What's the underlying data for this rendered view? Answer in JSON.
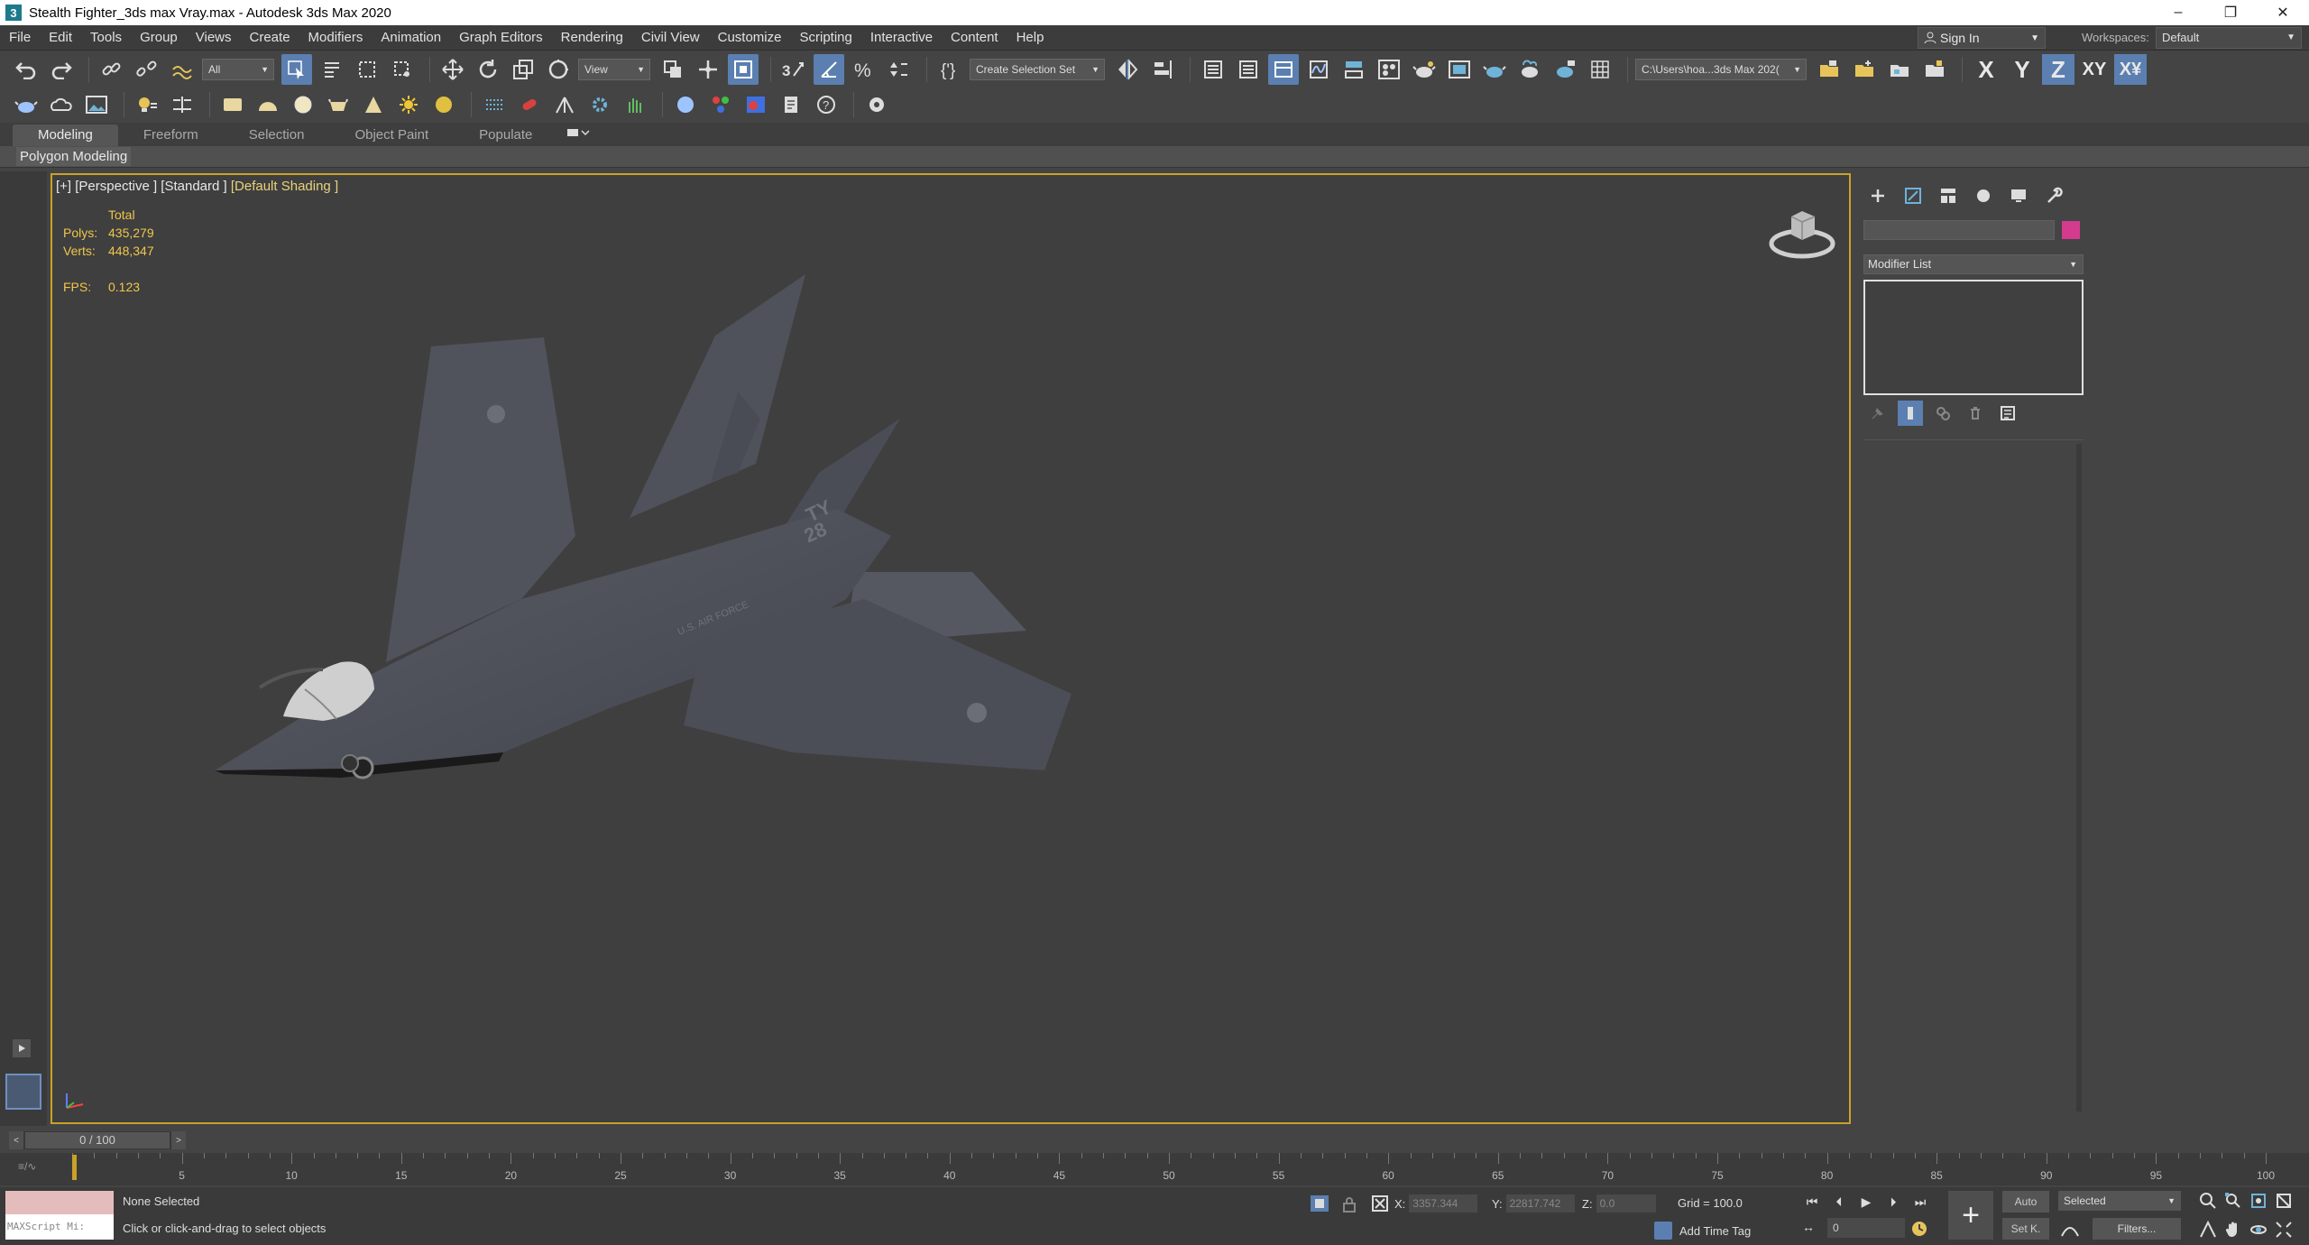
{
  "window": {
    "title": "Stealth Fighter_3ds max Vray.max - Autodesk 3ds Max 2020",
    "app_icon": "3",
    "minimize": "–",
    "maximize": "❐",
    "close": "✕"
  },
  "menu": [
    "File",
    "Edit",
    "Tools",
    "Group",
    "Views",
    "Create",
    "Modifiers",
    "Animation",
    "Graph Editors",
    "Rendering",
    "Civil View",
    "Customize",
    "Scripting",
    "Interactive",
    "Content",
    "Help"
  ],
  "account": {
    "sign_in": "Sign In",
    "workspaces_label": "Workspaces:",
    "workspace_value": "Default"
  },
  "toolbar": {
    "selection_filter": "All",
    "ref_coord": "View",
    "named_selection": "Create Selection Set",
    "project_path": "C:\\Users\\hoa...3ds Max 202(",
    "axes": [
      "X",
      "Y",
      "Z",
      "XY",
      "X¥"
    ]
  },
  "ribbon": {
    "tabs": [
      "Modeling",
      "Freeform",
      "Selection",
      "Object Paint",
      "Populate"
    ],
    "active_tab": "Modeling",
    "sub_label": "Polygon Modeling"
  },
  "viewport": {
    "label_prefix": "[+] [Perspective ] [Standard ] ",
    "label_shading": "[Default Shading ]",
    "stats": {
      "header": "Total",
      "polys_label": "Polys:",
      "polys": "435,279",
      "verts_label": "Verts:",
      "verts": "448,347",
      "fps_label": "FPS:",
      "fps": "0.123"
    },
    "decal_letters": "TY\n28",
    "decal_text": "U.S. AIR FORCE"
  },
  "command_panel": {
    "modifier_list": "Modifier List",
    "object_color": "#d43b8f"
  },
  "timeline": {
    "slider_value": "0 / 100",
    "slider_prev": "<",
    "slider_next": ">",
    "curve_label": "≡/∿",
    "ticks": [
      0,
      5,
      10,
      15,
      20,
      25,
      30,
      35,
      40,
      45,
      50,
      55,
      60,
      65,
      70,
      75,
      80,
      85,
      90,
      95,
      100
    ],
    "max_frame": 100
  },
  "status": {
    "maxscript_label": "MAXScript Mi:",
    "selection": "None Selected",
    "prompt": "Click or click-and-drag to select objects",
    "x_label": "X:",
    "x": "3357.344",
    "y_label": "Y:",
    "y": "22817.742",
    "z_label": "Z:",
    "z": "0.0",
    "grid": "Grid = 100.0",
    "add_time_tag": "Add Time Tag",
    "frame_value": "0",
    "auto_key": "Auto",
    "set_key": "Set K.",
    "selected": "Selected",
    "filters": "Filters..."
  },
  "colors": {
    "accent_blue": "#5b7fb0",
    "viewport_border": "#c9a227",
    "stats_text": "#f0c64a"
  }
}
